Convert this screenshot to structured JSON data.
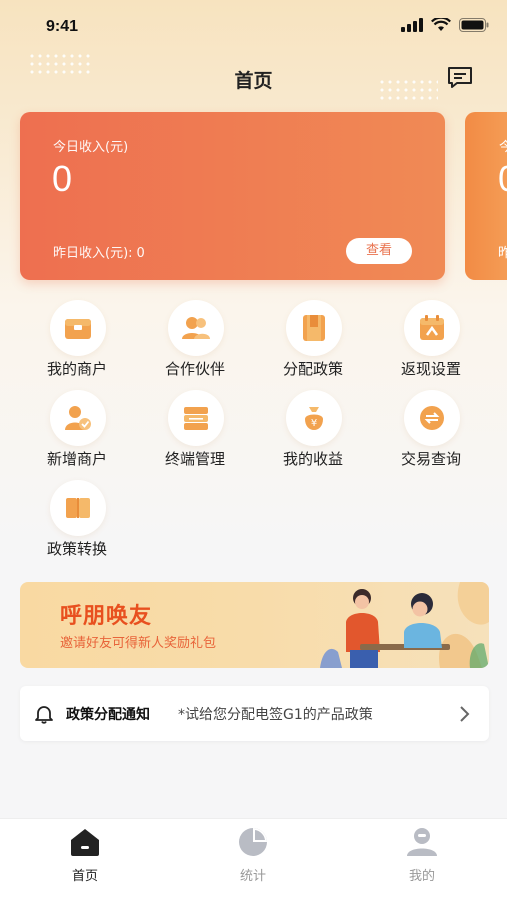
{
  "status_bar": {
    "time": "9:41"
  },
  "header": {
    "title": "首页"
  },
  "income_card": {
    "today_label": "今日收入(元)",
    "today_value": "0",
    "yesterday_label": "昨日收入(元):",
    "yesterday_value": "0",
    "view_button": "查看"
  },
  "next_card": {
    "label": "今",
    "value": "0",
    "sub": "昨"
  },
  "menu": [
    {
      "label": "我的商户",
      "icon": "merchant-icon"
    },
    {
      "label": "合作伙伴",
      "icon": "partners-icon"
    },
    {
      "label": "分配政策",
      "icon": "policy-allocation-icon"
    },
    {
      "label": "返现设置",
      "icon": "cashback-settings-icon"
    },
    {
      "label": "新增商户",
      "icon": "add-merchant-icon"
    },
    {
      "label": "终端管理",
      "icon": "terminal-management-icon"
    },
    {
      "label": "我的收益",
      "icon": "my-earnings-icon"
    },
    {
      "label": "交易查询",
      "icon": "transaction-query-icon"
    },
    {
      "label": "政策转换",
      "icon": "policy-conversion-icon"
    }
  ],
  "banner": {
    "title": "呼朋唤友",
    "subtitle": "邀请好友可得新人奖励礼包"
  },
  "notice": {
    "title": "政策分配通知",
    "text": "*试给您分配电签G1的产品政策"
  },
  "tabbar": {
    "items": [
      {
        "label": "首页",
        "icon": "home-icon",
        "active": true
      },
      {
        "label": "统计",
        "icon": "statistics-icon",
        "active": false
      },
      {
        "label": "我的",
        "icon": "profile-icon",
        "active": false
      }
    ]
  },
  "colors": {
    "accent": "#ee6f50",
    "icon_orange": "#f2a24e",
    "banner_title": "#e8501f"
  }
}
